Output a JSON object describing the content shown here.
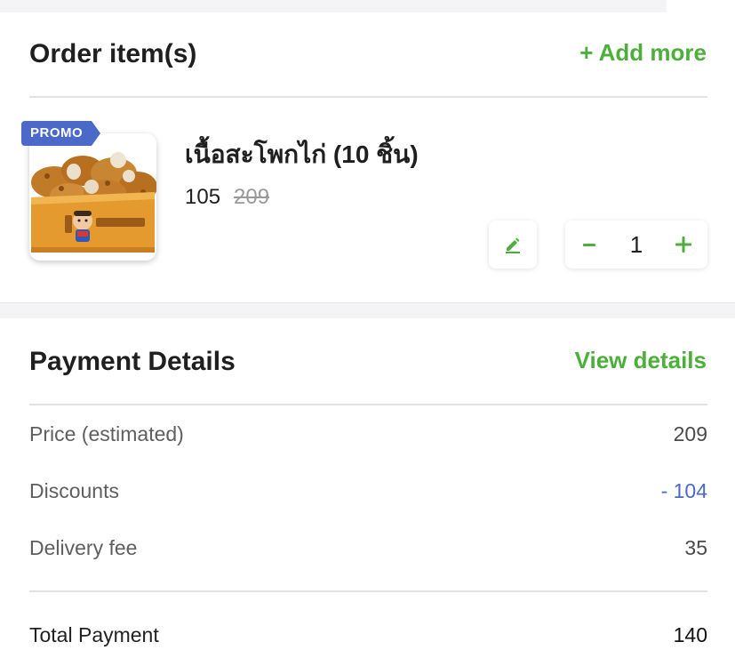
{
  "order": {
    "title": "Order item(s)",
    "add_more_label": "+ Add more",
    "item": {
      "promo_badge": "PROMO",
      "name": "เนื้อสะโพกไก่ (10 ชิ้น)",
      "price": "105",
      "original_price": "209",
      "quantity": "1",
      "quantity_minus_symbol": "−",
      "quantity_plus_symbol": "+",
      "edit_icon": "pencil-icon"
    }
  },
  "payment": {
    "title": "Payment Details",
    "view_details_label": "View details",
    "rows": [
      {
        "label": "Price (estimated)",
        "value": "209"
      },
      {
        "label": "Discounts",
        "value": "- 104"
      },
      {
        "label": "Delivery fee",
        "value": "35"
      }
    ],
    "total": {
      "label": "Total Payment",
      "value": "140"
    }
  },
  "colors": {
    "accent_green": "#4caf3a",
    "promo_blue": "#4a69c9",
    "discount_blue": "#4a69c9",
    "strike_gray": "#9a9a9a"
  }
}
